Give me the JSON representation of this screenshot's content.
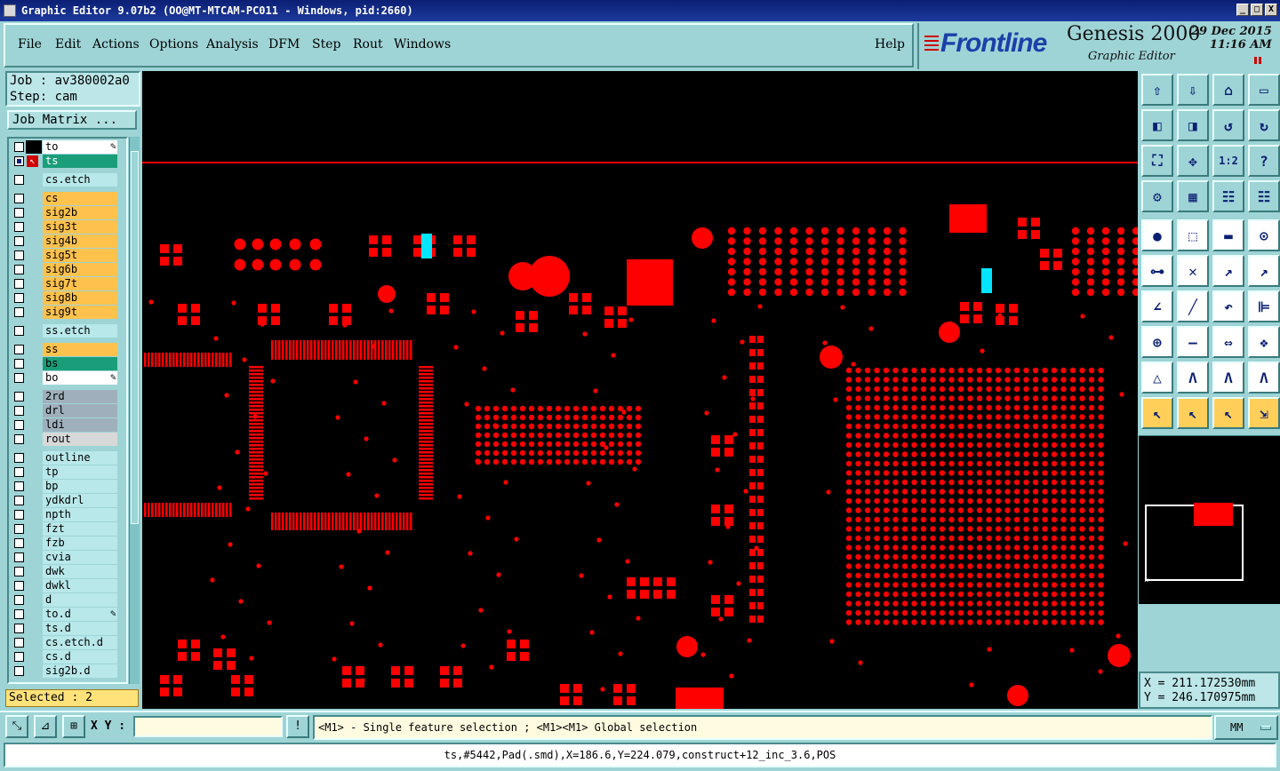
{
  "window": {
    "title": "Graphic Editor 9.07b2 (OO@MT-MTCAM-PC011 - Windows, pid:2660)",
    "controls": [
      "_",
      "□",
      "X"
    ]
  },
  "menu": {
    "items": [
      "File",
      "Edit",
      "Actions",
      "Options",
      "Analysis",
      "DFM",
      "Step",
      "Rout",
      "Windows"
    ],
    "help": "Help"
  },
  "branding": {
    "company": "Frontline",
    "product": "Genesis 2000",
    "subtitle": "Graphic Editor",
    "date": "29 Dec 2015",
    "time": "11:16 AM"
  },
  "job": {
    "job_label": "Job : av380002a0",
    "step_label": "Step: cam",
    "matrix_button": "Job Matrix ..."
  },
  "layers": [
    {
      "name": "to",
      "color": "#ffffff",
      "marker": "pen"
    },
    {
      "name": "ts",
      "color": "#1a9e7a",
      "active": true
    },
    {
      "name": "cs.etch",
      "color": "#b8e8ea"
    },
    {
      "name": "cs",
      "color": "#ffc24d"
    },
    {
      "name": "sig2b",
      "color": "#ffc24d"
    },
    {
      "name": "sig3t",
      "color": "#ffc24d"
    },
    {
      "name": "sig4b",
      "color": "#ffc24d"
    },
    {
      "name": "sig5t",
      "color": "#ffc24d"
    },
    {
      "name": "sig6b",
      "color": "#ffc24d"
    },
    {
      "name": "sig7t",
      "color": "#ffc24d"
    },
    {
      "name": "sig8b",
      "color": "#ffc24d"
    },
    {
      "name": "sig9t",
      "color": "#ffc24d"
    },
    {
      "name": "ss.etch",
      "color": "#b8e8ea"
    },
    {
      "name": "ss",
      "color": "#ffc24d"
    },
    {
      "name": "bs",
      "color": "#1a9e7a"
    },
    {
      "name": "bo",
      "color": "#ffffff",
      "marker": "pen"
    },
    {
      "name": "2rd",
      "color": "#9fb0bc"
    },
    {
      "name": "drl",
      "color": "#9fb0bc"
    },
    {
      "name": "ldi",
      "color": "#9fb0bc"
    },
    {
      "name": "rout",
      "color": "#d8d8d8"
    },
    {
      "name": "outline",
      "color": "#b8e8ea"
    },
    {
      "name": "tp",
      "color": "#b8e8ea"
    },
    {
      "name": "bp",
      "color": "#b8e8ea"
    },
    {
      "name": "ydkdrl",
      "color": "#b8e8ea"
    },
    {
      "name": "npth",
      "color": "#b8e8ea"
    },
    {
      "name": "fzt",
      "color": "#b8e8ea"
    },
    {
      "name": "fzb",
      "color": "#b8e8ea"
    },
    {
      "name": "cvia",
      "color": "#b8e8ea"
    },
    {
      "name": "dwk",
      "color": "#b8e8ea"
    },
    {
      "name": "dwkl",
      "color": "#b8e8ea"
    },
    {
      "name": "d",
      "color": "#b8e8ea"
    },
    {
      "name": "to.d",
      "color": "#b8e8ea",
      "marker": "pen"
    },
    {
      "name": "ts.d",
      "color": "#b8e8ea"
    },
    {
      "name": "cs.etch.d",
      "color": "#b8e8ea"
    },
    {
      "name": "cs.d",
      "color": "#b8e8ea"
    },
    {
      "name": "sig2b.d",
      "color": "#b8e8ea"
    }
  ],
  "selection": {
    "label": "Selected : 2"
  },
  "coords": {
    "x": "X = 211.172530mm",
    "y": "Y = 246.170975mm"
  },
  "bottom": {
    "xy_label": "X Y :",
    "xy_value": "",
    "prompt": "<M1> - Single feature selection ; <M1><M1> Global selection",
    "unit": "MM"
  },
  "status": {
    "text": "ts,#5442,Pad(.smd),X=186.6,Y=224.079,construct+12_inc_3.6,POS"
  },
  "toolbar_icons": [
    "open-icon",
    "save-icon",
    "home-icon",
    "window-icon",
    "zoom-in-icon",
    "zoom-out-icon",
    "undo-icon",
    "redo-icon",
    "fit-icon",
    "center-icon",
    "ratio-icon",
    "help-icon",
    "settings-icon",
    "grid-icon",
    "layers-icon",
    "layers-active-icon",
    "snap-icon",
    "measure-icon",
    "ruler-icon",
    "pad-icon",
    "net-icon",
    "cross-icon",
    "connect-icon",
    "connect2-icon",
    "line-icon",
    "line2-icon",
    "arc-icon",
    "text-icon",
    "add-icon",
    "dash-icon",
    "dim-icon",
    "shapes-icon",
    "ramp-icon",
    "peak-icon",
    "peak2-icon",
    "peak3-icon",
    "select-icon",
    "select2-icon",
    "select3-icon",
    "move-icon"
  ],
  "colors": {
    "pcb": "#ff0000",
    "highlight": "#00e5ff",
    "background": "#000000"
  }
}
